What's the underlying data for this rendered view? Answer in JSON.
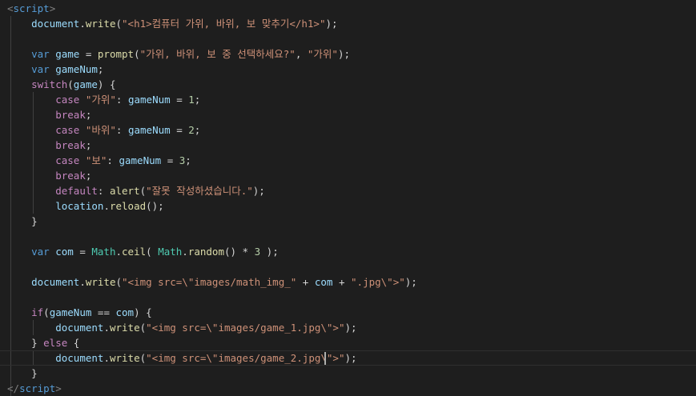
{
  "editor": {
    "colors": {
      "background": "#1e1e1e",
      "tag": "#569cd6",
      "punctuation": "#808080",
      "variable": "#9cdcfe",
      "function": "#dcdcaa",
      "string": "#ce9178",
      "keyword": "#569cd6",
      "control": "#c586c0",
      "number": "#b5cea8",
      "class": "#4ec9b0",
      "plain": "#d4d4d4"
    },
    "current_line": 23,
    "lines": [
      [
        [
          "t-punct",
          "<"
        ],
        [
          "t-tag",
          "script"
        ],
        [
          "t-punct",
          ">"
        ]
      ],
      [
        [
          "t-op",
          "    "
        ],
        [
          "t-id",
          "document"
        ],
        [
          "t-op",
          "."
        ],
        [
          "t-fn",
          "write"
        ],
        [
          "t-op",
          "("
        ],
        [
          "t-str",
          "\"<h1>컴퓨터 가위, 바위, 보 맞추기</h1>\""
        ],
        [
          "t-op",
          ");"
        ]
      ],
      [],
      [
        [
          "t-op",
          "    "
        ],
        [
          "t-kw",
          "var"
        ],
        [
          "t-op",
          " "
        ],
        [
          "t-id",
          "game"
        ],
        [
          "t-op",
          " = "
        ],
        [
          "t-fn",
          "prompt"
        ],
        [
          "t-op",
          "("
        ],
        [
          "t-str",
          "\"가위, 바위, 보 중 선택하세요?\""
        ],
        [
          "t-op",
          ", "
        ],
        [
          "t-str",
          "\"가위\""
        ],
        [
          "t-op",
          ");"
        ]
      ],
      [
        [
          "t-op",
          "    "
        ],
        [
          "t-kw",
          "var"
        ],
        [
          "t-op",
          " "
        ],
        [
          "t-id",
          "gameNum"
        ],
        [
          "t-op",
          ";"
        ]
      ],
      [
        [
          "t-op",
          "    "
        ],
        [
          "t-ctl",
          "switch"
        ],
        [
          "t-op",
          "("
        ],
        [
          "t-id",
          "game"
        ],
        [
          "t-op",
          ") {"
        ]
      ],
      [
        [
          "t-op",
          "        "
        ],
        [
          "t-ctl",
          "case"
        ],
        [
          "t-op",
          " "
        ],
        [
          "t-str",
          "\"가위\""
        ],
        [
          "t-op",
          ": "
        ],
        [
          "t-id",
          "gameNum"
        ],
        [
          "t-op",
          " = "
        ],
        [
          "t-num",
          "1"
        ],
        [
          "t-op",
          ";"
        ]
      ],
      [
        [
          "t-op",
          "        "
        ],
        [
          "t-ctl",
          "break"
        ],
        [
          "t-op",
          ";"
        ]
      ],
      [
        [
          "t-op",
          "        "
        ],
        [
          "t-ctl",
          "case"
        ],
        [
          "t-op",
          " "
        ],
        [
          "t-str",
          "\"바위\""
        ],
        [
          "t-op",
          ": "
        ],
        [
          "t-id",
          "gameNum"
        ],
        [
          "t-op",
          " = "
        ],
        [
          "t-num",
          "2"
        ],
        [
          "t-op",
          ";"
        ]
      ],
      [
        [
          "t-op",
          "        "
        ],
        [
          "t-ctl",
          "break"
        ],
        [
          "t-op",
          ";"
        ]
      ],
      [
        [
          "t-op",
          "        "
        ],
        [
          "t-ctl",
          "case"
        ],
        [
          "t-op",
          " "
        ],
        [
          "t-str",
          "\"보\""
        ],
        [
          "t-op",
          ": "
        ],
        [
          "t-id",
          "gameNum"
        ],
        [
          "t-op",
          " = "
        ],
        [
          "t-num",
          "3"
        ],
        [
          "t-op",
          ";"
        ]
      ],
      [
        [
          "t-op",
          "        "
        ],
        [
          "t-ctl",
          "break"
        ],
        [
          "t-op",
          ";"
        ]
      ],
      [
        [
          "t-op",
          "        "
        ],
        [
          "t-ctl",
          "default"
        ],
        [
          "t-op",
          ": "
        ],
        [
          "t-fn",
          "alert"
        ],
        [
          "t-op",
          "("
        ],
        [
          "t-str",
          "\"잘못 작성하셨습니다.\""
        ],
        [
          "t-op",
          ");"
        ]
      ],
      [
        [
          "t-op",
          "        "
        ],
        [
          "t-id",
          "location"
        ],
        [
          "t-op",
          "."
        ],
        [
          "t-fn",
          "reload"
        ],
        [
          "t-op",
          "();"
        ]
      ],
      [
        [
          "t-op",
          "    }"
        ]
      ],
      [],
      [
        [
          "t-op",
          "    "
        ],
        [
          "t-kw",
          "var"
        ],
        [
          "t-op",
          " "
        ],
        [
          "t-id",
          "com"
        ],
        [
          "t-op",
          " = "
        ],
        [
          "t-cls",
          "Math"
        ],
        [
          "t-op",
          "."
        ],
        [
          "t-fn",
          "ceil"
        ],
        [
          "t-op",
          "( "
        ],
        [
          "t-cls",
          "Math"
        ],
        [
          "t-op",
          "."
        ],
        [
          "t-fn",
          "random"
        ],
        [
          "t-op",
          "() * "
        ],
        [
          "t-num",
          "3"
        ],
        [
          "t-op",
          " );"
        ]
      ],
      [],
      [
        [
          "t-op",
          "    "
        ],
        [
          "t-id",
          "document"
        ],
        [
          "t-op",
          "."
        ],
        [
          "t-fn",
          "write"
        ],
        [
          "t-op",
          "("
        ],
        [
          "t-str",
          "\"<img src=\\\"images/math_img_\""
        ],
        [
          "t-op",
          " + "
        ],
        [
          "t-id",
          "com"
        ],
        [
          "t-op",
          " + "
        ],
        [
          "t-str",
          "\".jpg\\\">\""
        ],
        [
          "t-op",
          ");"
        ]
      ],
      [],
      [
        [
          "t-op",
          "    "
        ],
        [
          "t-ctl",
          "if"
        ],
        [
          "t-op",
          "("
        ],
        [
          "t-id",
          "gameNum"
        ],
        [
          "t-op",
          " == "
        ],
        [
          "t-id",
          "com"
        ],
        [
          "t-op",
          ") {"
        ]
      ],
      [
        [
          "t-op",
          "        "
        ],
        [
          "t-id",
          "document"
        ],
        [
          "t-op",
          "."
        ],
        [
          "t-fn",
          "write"
        ],
        [
          "t-op",
          "("
        ],
        [
          "t-str",
          "\"<img src=\\\"images/game_1.jpg\\\">\""
        ],
        [
          "t-op",
          ");"
        ]
      ],
      [
        [
          "t-op",
          "    } "
        ],
        [
          "t-ctl",
          "else"
        ],
        [
          "t-op",
          " {"
        ]
      ],
      [
        [
          "t-op",
          "        "
        ],
        [
          "t-id",
          "document"
        ],
        [
          "t-op",
          "."
        ],
        [
          "t-fn",
          "write"
        ],
        [
          "t-op",
          "("
        ],
        [
          "t-str",
          "\"<img src=\\\"images/game_2.jpg\\\">\""
        ],
        [
          "t-op",
          ")"
        ],
        [
          "t-op",
          ";"
        ]
      ],
      [
        [
          "t-op",
          "    }"
        ]
      ],
      [
        [
          "t-punct",
          "</"
        ],
        [
          "t-tag",
          "script"
        ],
        [
          "t-punct",
          ">"
        ]
      ]
    ]
  }
}
